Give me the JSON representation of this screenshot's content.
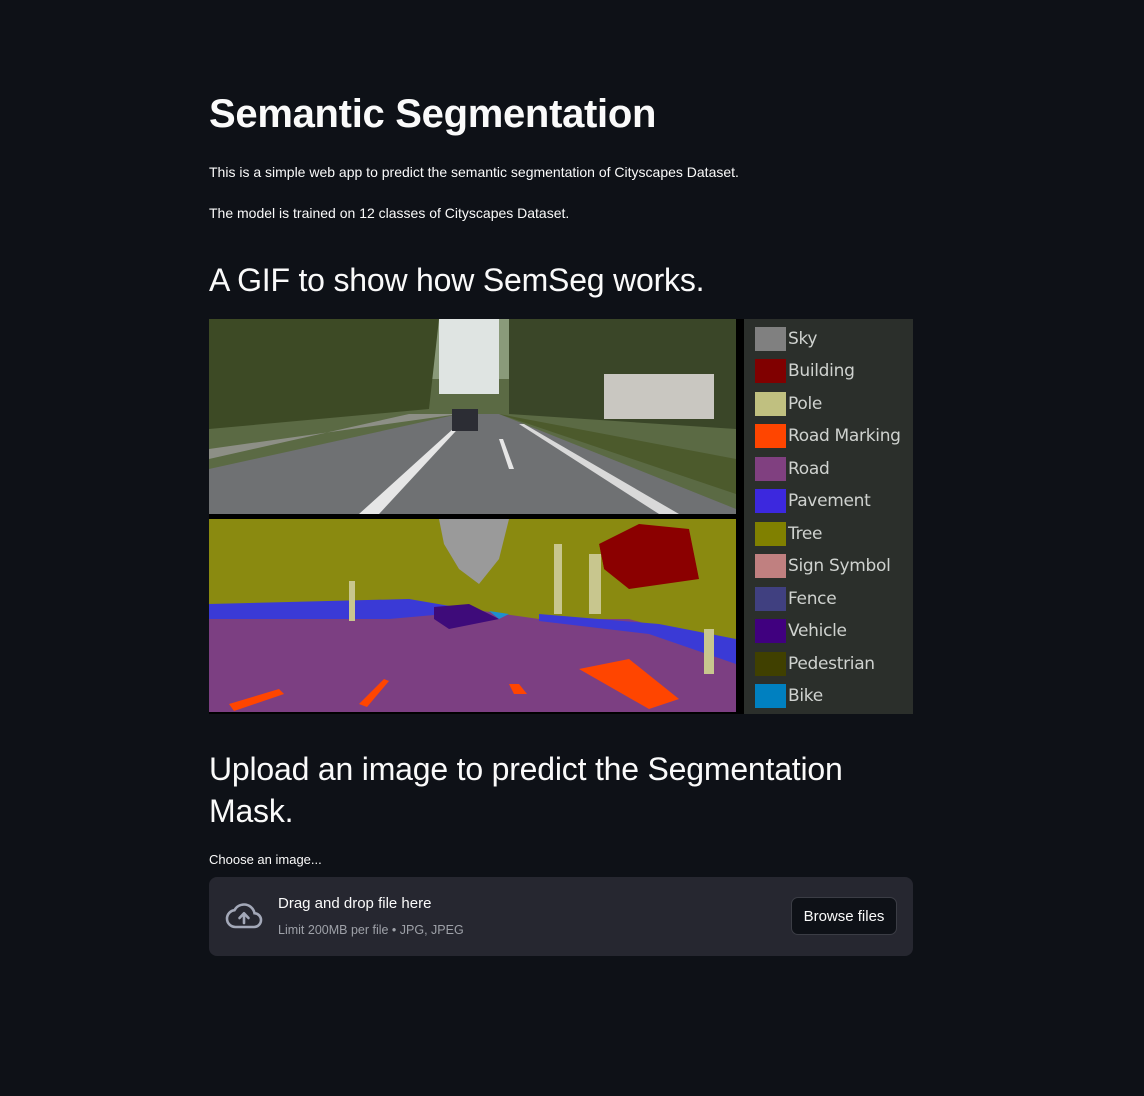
{
  "page": {
    "title": "Semantic Segmentation",
    "intro": "This is a simple web app to predict the semantic segmentation of Cityscapes Dataset.",
    "model_note": "The model is trained on 12 classes of Cityscapes Dataset."
  },
  "gif_section": {
    "heading": "A GIF to show how SemSeg works.",
    "legend": [
      {
        "label": "Sky",
        "color": "#808080"
      },
      {
        "label": "Building",
        "color": "#800000"
      },
      {
        "label": "Pole",
        "color": "#c0c080"
      },
      {
        "label": "Road Marking",
        "color": "#ff4500"
      },
      {
        "label": "Road",
        "color": "#804080"
      },
      {
        "label": "Pavement",
        "color": "#3c28de"
      },
      {
        "label": "Tree",
        "color": "#808000"
      },
      {
        "label": "Sign Symbol",
        "color": "#c08080"
      },
      {
        "label": "Fence",
        "color": "#404080"
      },
      {
        "label": "Vehicle",
        "color": "#40007f"
      },
      {
        "label": "Pedestrian",
        "color": "#404000"
      },
      {
        "label": "Bike",
        "color": "#0080c0"
      }
    ]
  },
  "upload_section": {
    "heading": "Upload an image to predict the Segmentation Mask.",
    "label": "Choose an image...",
    "drop_text": "Drag and drop file here",
    "limit_text": "Limit 200MB per file • JPG, JPEG",
    "browse_label": "Browse files"
  },
  "colors": {
    "background": "#0e1117",
    "dropzone": "#262730",
    "text": "#fafafa",
    "muted": "#9ea1a8"
  }
}
